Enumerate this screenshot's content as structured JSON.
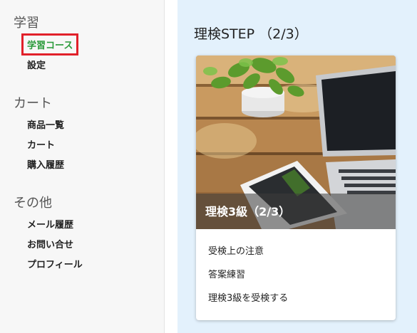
{
  "sidebar": {
    "sections": [
      {
        "title": "学習",
        "items": [
          {
            "label": "学習コース"
          },
          {
            "label": "設定"
          }
        ]
      },
      {
        "title": "カート",
        "items": [
          {
            "label": "商品一覧"
          },
          {
            "label": "カート"
          },
          {
            "label": "購入履歴"
          }
        ]
      },
      {
        "title": "その他",
        "items": [
          {
            "label": "メール履歴"
          },
          {
            "label": "お問い合せ"
          },
          {
            "label": "プロフィール"
          }
        ]
      }
    ],
    "active_item": "学習コース"
  },
  "main": {
    "page_title": "理検STEP （2/3）",
    "card": {
      "image_title": "理検3級（2/3）",
      "links": [
        {
          "label": "受検上の注意"
        },
        {
          "label": "答案練習"
        },
        {
          "label": "理検3級を受検する"
        }
      ]
    }
  },
  "colors": {
    "active_item_text": "#2a9a3a",
    "active_item_outline": "#e1202a",
    "main_background": "#e3f1fc",
    "sidebar_background": "#f7f7f7"
  }
}
